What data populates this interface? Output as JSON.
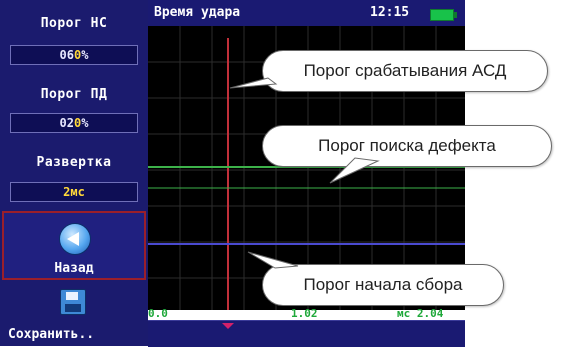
{
  "sidebar": {
    "threshold_ns": {
      "label": "Порог НС",
      "value_prefix": "06",
      "value_hl": "0",
      "value_suffix": "%"
    },
    "threshold_pd": {
      "label": "Порог ПД",
      "value_prefix": "02",
      "value_hl": "0",
      "value_suffix": "%"
    },
    "sweep": {
      "label": "Развертка",
      "value": "2мс"
    },
    "back_label": "Назад",
    "save_label": "Сохранить.."
  },
  "header": {
    "title": "Время удара",
    "time": "12:15"
  },
  "axis": {
    "tick_start": "0.0",
    "tick_mid": "1.02",
    "tick_end": "мс 2.04"
  },
  "callouts": {
    "asd": "Порог срабатывания АСД",
    "defect": "Порог поиска дефекта",
    "collect": "Порог начала сбора"
  },
  "colors": {
    "asd_line": "#c2303a",
    "defect_line": "#3db24a",
    "collect_line": "#4a4ad0",
    "grid": "#2c2c2c",
    "tick_green": "#1fa83a"
  },
  "icons": {
    "back": "arrow-left-icon",
    "save": "floppy-disk-icon",
    "battery": "battery-icon"
  }
}
